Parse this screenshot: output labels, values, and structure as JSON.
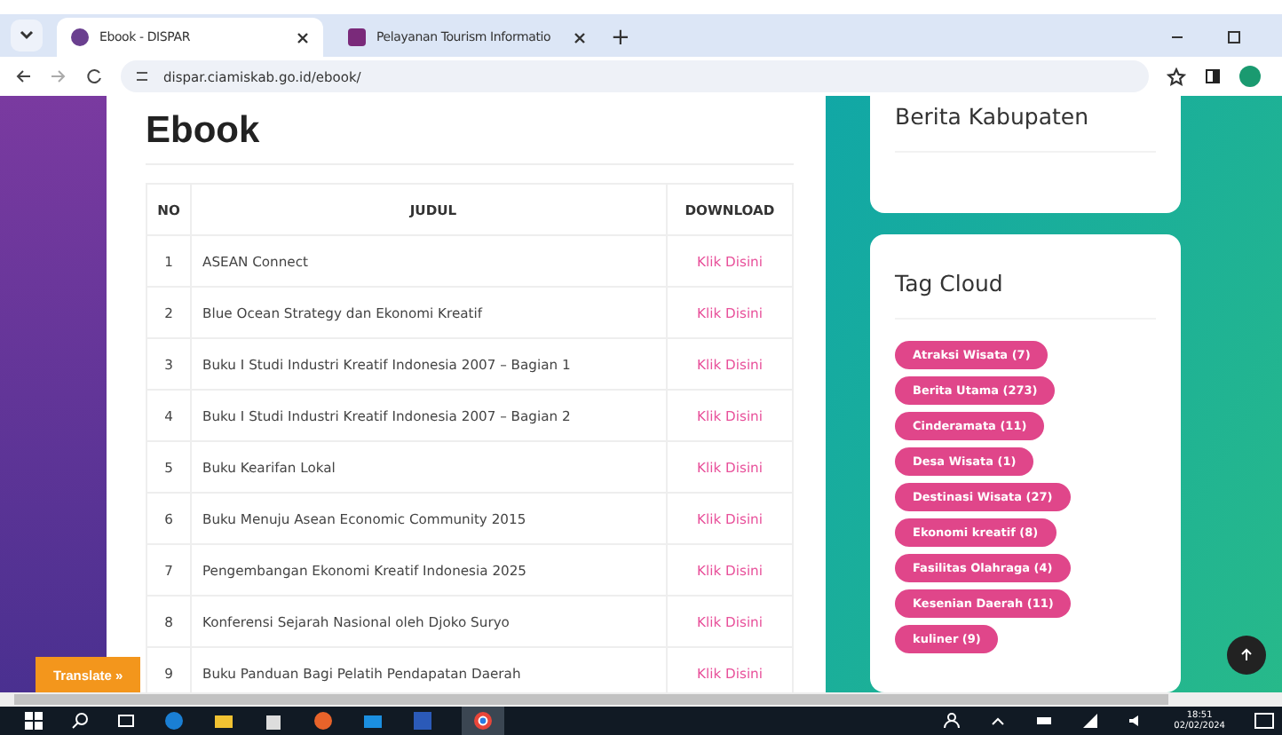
{
  "browser": {
    "tabs": [
      {
        "title": "Ebook - DISPAR",
        "selected": true
      },
      {
        "title": "Pelayanan Tourism Informatio",
        "selected": false
      }
    ],
    "new_tab": "+",
    "url": "dispar.ciamiskab.go.id/ebook/"
  },
  "page": {
    "heading": "Ebook",
    "table": {
      "columns": [
        "NO",
        "JUDUL",
        "DOWNLOAD"
      ],
      "rows": [
        {
          "no": "1",
          "title": "ASEAN Connect",
          "link": "Klik Disini"
        },
        {
          "no": "2",
          "title": "Blue Ocean Strategy dan Ekonomi Kreatif",
          "link": "Klik Disini"
        },
        {
          "no": "3",
          "title": "Buku I Studi Industri Kreatif Indonesia 2007 – Bagian 1",
          "link": "Klik Disini"
        },
        {
          "no": "4",
          "title": "Buku I Studi Industri Kreatif Indonesia 2007 – Bagian 2",
          "link": "Klik Disini"
        },
        {
          "no": "5",
          "title": "Buku Kearifan Lokal",
          "link": "Klik Disini"
        },
        {
          "no": "6",
          "title": "Buku Menuju Asean Economic Community 2015",
          "link": "Klik Disini"
        },
        {
          "no": "7",
          "title": "Pengembangan Ekonomi Kreatif Indonesia 2025",
          "link": "Klik Disini"
        },
        {
          "no": "8",
          "title": "Konferensi Sejarah Nasional oleh Djoko Suryo",
          "link": "Klik Disini"
        },
        {
          "no": "9",
          "title": "Buku Panduan Bagi Pelatih Pendapatan Daerah",
          "link": "Klik Disini"
        }
      ]
    },
    "sidebar": {
      "news_title": "Berita Kabupaten",
      "tag_title": "Tag Cloud",
      "tags": [
        "Atraksi Wisata (7)",
        "Berita Utama (273)",
        "Cinderamata (11)",
        "Desa Wisata (1)",
        "Destinasi Wisata (27)",
        "Ekonomi kreatif (8)",
        "Fasilitas Olahraga (4)",
        "Kesenian Daerah (11)",
        "kuliner (9)"
      ]
    },
    "translate": "Translate »"
  },
  "taskbar": {
    "time": "18:51",
    "date": "02/02/2024"
  }
}
